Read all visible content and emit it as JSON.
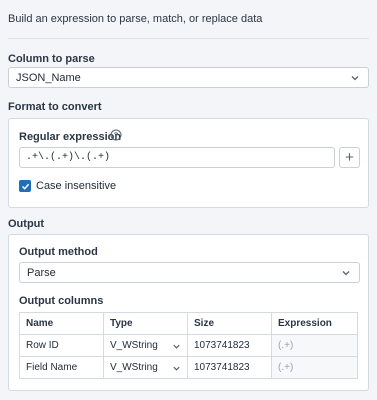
{
  "description": "Build an expression to parse, match, or replace data",
  "column_to_parse": {
    "label": "Column to parse",
    "selected": "JSON_Name"
  },
  "format_to_convert": {
    "label": "Format to convert",
    "regex_label": "Regular expression",
    "regex_value": ".+\\.(.+)\\.(.+)",
    "add_button_label": "+",
    "case_insensitive_label": "Case insensitive",
    "case_insensitive_checked": true
  },
  "output": {
    "label": "Output",
    "method_label": "Output method",
    "method_selected": "Parse",
    "columns_label": "Output columns",
    "headers": [
      "Name",
      "Type",
      "Size",
      "Expression"
    ],
    "rows": [
      {
        "name": "Row ID",
        "type": "V_WString",
        "size": "1073741823",
        "expression": "(.+)"
      },
      {
        "name": "Field Name",
        "type": "V_WString",
        "size": "1073741823",
        "expression": "(.+)"
      }
    ]
  },
  "colors": {
    "accent": "#1e6fb8",
    "background": "#f3f5f8"
  }
}
